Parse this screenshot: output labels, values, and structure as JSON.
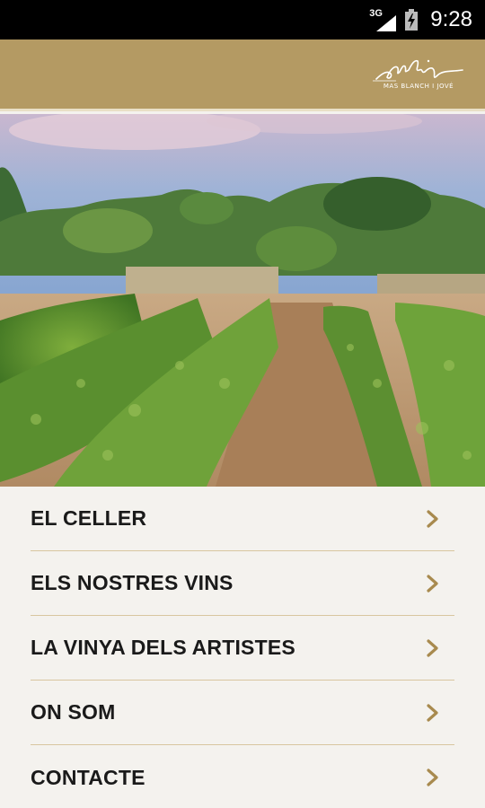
{
  "status_bar": {
    "network": "3G",
    "time": "9:28",
    "icons": [
      "signal-icon",
      "battery-charging-icon"
    ]
  },
  "header": {
    "logo_text": "MAS BLANCH I JOVÉ",
    "brand_color": "#b49a63"
  },
  "hero": {
    "image": "vineyard-photo"
  },
  "menu": {
    "items": [
      {
        "label": "EL CELLER",
        "icon": "chevron-right-icon"
      },
      {
        "label": "ELS NOSTRES VINS",
        "icon": "chevron-right-icon"
      },
      {
        "label": "LA VINYA DELS ARTISTES",
        "icon": "chevron-right-icon"
      },
      {
        "label": "ON SOM",
        "icon": "chevron-right-icon"
      },
      {
        "label": "CONTACTE",
        "icon": "chevron-right-icon"
      }
    ],
    "chevron_color": "#a88a4e"
  }
}
